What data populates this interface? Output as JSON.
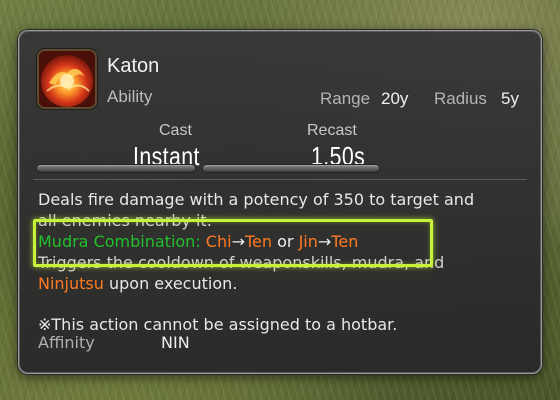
{
  "action": {
    "name": "Katon",
    "type": "Ability",
    "range_label": "Range",
    "range_value": "20y",
    "radius_label": "Radius",
    "radius_value": "5y",
    "cast_label": "Cast",
    "cast_value": "Instant",
    "recast_label": "Recast",
    "recast_value": "1.50s",
    "icon": "katon-fire-icon"
  },
  "description": {
    "line1": "Deals fire damage with a potency of 350 to target and",
    "line2": "all enemies nearby it.",
    "mudra_label": "Mudra Combination:",
    "combo1_a": "Chi",
    "arrow1": "→",
    "combo1_b": "Ten",
    "or_word": "or",
    "combo2_a": "Jin",
    "arrow2": "→",
    "combo2_b": "Ten",
    "line4": "Triggers the cooldown of weaponskills, mudra, and",
    "ninjutsu": "Ninjutsu",
    "line5_rest": "upon execution.",
    "note": "※This action cannot be assigned to a hotbar."
  },
  "affinity": {
    "label": "Affinity",
    "value": "NIN"
  },
  "colors": {
    "mudra_green": "#22c02c",
    "mudra_orange": "#ff7a22",
    "highlight": "#c6f23a"
  }
}
